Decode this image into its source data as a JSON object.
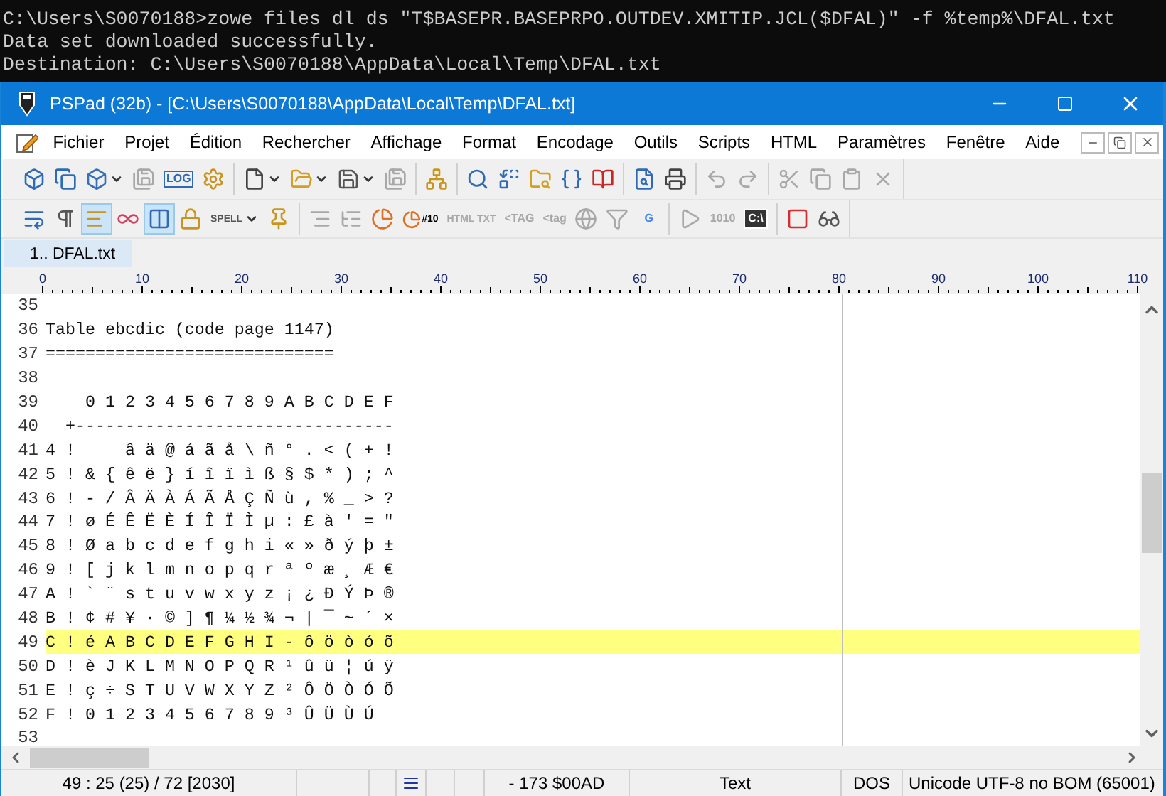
{
  "terminal": {
    "lines": [
      "C:\\Users\\S0070188>zowe files dl ds \"T$BASEPR.BASEPRPO.OUTDEV.XMITIP.JCL($DFAL)\" -f %temp%\\DFAL.txt",
      "Data set downloaded successfully.",
      "Destination: C:\\Users\\S0070188\\AppData\\Local\\Temp\\DFAL.txt"
    ]
  },
  "window": {
    "title": "PSPad (32b) - [C:\\Users\\S0070188\\AppData\\Local\\Temp\\DFAL.txt]"
  },
  "menu": [
    "Fichier",
    "Projet",
    "Édition",
    "Rechercher",
    "Affichage",
    "Format",
    "Encodage",
    "Outils",
    "Scripts",
    "HTML",
    "Paramètres",
    "Fenêtre",
    "Aide"
  ],
  "toolbars": [
    {
      "groups": [
        [
          {
            "pressed": false,
            "disabled": false,
            "menu": false
          },
          {
            "pressed": false,
            "disabled": false,
            "menu": false
          },
          {
            "pressed": false,
            "disabled": false,
            "menu": true
          },
          {
            "pressed": false,
            "disabled": true,
            "menu": false
          },
          {
            "pressed": false,
            "disabled": false,
            "menu": false,
            "label": "LOG"
          },
          {
            "pressed": false,
            "disabled": false,
            "menu": false
          }
        ],
        [
          {
            "pressed": false,
            "disabled": false,
            "menu": true
          },
          {
            "pressed": false,
            "disabled": false,
            "menu": true
          },
          {
            "pressed": false,
            "disabled": false,
            "menu": true
          },
          {
            "pressed": false,
            "disabled": true,
            "menu": false
          }
        ],
        [
          {
            "pressed": false,
            "disabled": false,
            "menu": false
          }
        ],
        [
          {
            "pressed": false,
            "disabled": false,
            "menu": false
          },
          {
            "pressed": false,
            "disabled": false,
            "menu": false
          },
          {
            "pressed": false,
            "disabled": false,
            "menu": false
          },
          {
            "pressed": false,
            "disabled": false,
            "menu": false
          },
          {
            "pressed": false,
            "disabled": false,
            "menu": false
          }
        ],
        [
          {
            "pressed": false,
            "disabled": false,
            "menu": false
          },
          {
            "pressed": false,
            "disabled": false,
            "menu": false
          }
        ],
        [
          {
            "pressed": false,
            "disabled": true,
            "menu": false
          },
          {
            "pressed": false,
            "disabled": true,
            "menu": false
          }
        ],
        [
          {
            "pressed": false,
            "disabled": true,
            "menu": false
          },
          {
            "pressed": false,
            "disabled": true,
            "menu": false
          },
          {
            "pressed": false,
            "disabled": true,
            "menu": false
          },
          {
            "pressed": false,
            "disabled": true,
            "menu": false
          }
        ]
      ]
    },
    {
      "groups": [
        [
          {
            "pressed": false,
            "disabled": false,
            "menu": false
          },
          {
            "pressed": false,
            "disabled": false,
            "menu": false
          },
          {
            "pressed": true,
            "disabled": false,
            "menu": false
          },
          {
            "pressed": false,
            "disabled": false,
            "menu": false
          },
          {
            "pressed": true,
            "disabled": false,
            "menu": false
          },
          {
            "pressed": false,
            "disabled": false,
            "menu": false
          },
          {
            "pressed": false,
            "disabled": false,
            "menu": true,
            "label": "SPELL"
          },
          {
            "pressed": false,
            "disabled": false,
            "menu": false
          }
        ],
        [
          {
            "pressed": false,
            "disabled": true,
            "menu": false
          },
          {
            "pressed": false,
            "disabled": true,
            "menu": false
          },
          {
            "pressed": false,
            "disabled": false,
            "menu": false
          },
          {
            "pressed": false,
            "disabled": false,
            "menu": false,
            "label": "#10"
          },
          {
            "pressed": false,
            "disabled": true,
            "menu": false,
            "label": "HTML TXT"
          },
          {
            "pressed": false,
            "disabled": true,
            "menu": false,
            "label": "<TAG"
          },
          {
            "pressed": false,
            "disabled": true,
            "menu": false,
            "label": "<tag"
          },
          {
            "pressed": false,
            "disabled": true,
            "menu": false
          },
          {
            "pressed": false,
            "disabled": true,
            "menu": false
          },
          {
            "pressed": false,
            "disabled": false,
            "menu": false,
            "label": "G"
          }
        ],
        [
          {
            "pressed": false,
            "disabled": true,
            "menu": false
          },
          {
            "pressed": false,
            "disabled": true,
            "menu": false,
            "label": "1010"
          },
          {
            "pressed": false,
            "disabled": false,
            "menu": false,
            "label": "C:\\"
          }
        ],
        [
          {
            "pressed": false,
            "disabled": false,
            "menu": false
          },
          {
            "pressed": false,
            "disabled": false,
            "menu": false
          }
        ]
      ]
    }
  ],
  "tabs": [
    {
      "label": "1.. DFAL.txt",
      "selected": true
    }
  ],
  "ruler": {
    "labels": [
      "0",
      "10",
      "20",
      "30",
      "40",
      "50",
      "60",
      "70",
      "80",
      "90",
      "100",
      "110"
    ]
  },
  "editor": {
    "lines": [
      {
        "number": "35",
        "current": false
      },
      {
        "number": "36",
        "text": "Table ebcdic (code page 1147)",
        "current": false
      },
      {
        "number": "37",
        "text": "=============================",
        "current": false
      },
      {
        "number": "38",
        "current": false
      },
      {
        "number": "39",
        "text": "    0 1 2 3 4 5 6 7 8 9 A B C D E F",
        "current": false
      },
      {
        "number": "40",
        "text": "  +--------------------------------",
        "current": false
      },
      {
        "number": "41",
        "text": "4 !     â ä @ á ã å \\ ñ ° . < ( + !",
        "current": false
      },
      {
        "number": "42",
        "text": "5 ! & { ê ë } í î ï ì ß § $ * ) ; ^",
        "current": false
      },
      {
        "number": "43",
        "text": "6 ! - / Â Ä À Á Ã Å Ç Ñ ù , % _ > ?",
        "current": false
      },
      {
        "number": "44",
        "text": "7 ! ø É Ê Ë È Í Î Ï Ì µ : £ à ' = \"",
        "current": false
      },
      {
        "number": "45",
        "text": "8 ! Ø a b c d e f g h i « » ð ý þ ±",
        "current": false
      },
      {
        "number": "46",
        "text": "9 ! [ j k l m n o p q r ª º æ ¸ Æ €",
        "current": false
      },
      {
        "number": "47",
        "text": "A ! ` ¨ s t u v w x y z ¡ ¿ Ð Ý Þ ®",
        "current": false
      },
      {
        "number": "48",
        "text": "B ! ¢ # ¥ · © ] ¶ ¼ ½ ¾ ¬ | ¯ ~ ´ ×",
        "current": false
      },
      {
        "number": "49",
        "text": "C ! é A B C D E F G H I - ô ö ò ó õ",
        "current": true
      },
      {
        "number": "50",
        "text": "D ! è J K L M N O P Q R ¹ û ü ¦ ú ÿ",
        "current": false
      },
      {
        "number": "51",
        "text": "E ! ç ÷ S T U V W X Y Z ² Ô Ö Ò Ó Õ",
        "current": false
      },
      {
        "number": "52",
        "text": "F ! 0 1 2 3 4 5 6 7 8 9 ³ Û Ü Ù Ú",
        "current": false
      },
      {
        "number": "53",
        "current": false
      }
    ]
  },
  "status_bar": {
    "position": "49 : 25 (25) / 72  [2030]",
    "char_info": "-  173  $00AD",
    "mode": "Text",
    "line_ending": "DOS",
    "encoding": "Unicode UTF-8 no BOM (65001)"
  }
}
